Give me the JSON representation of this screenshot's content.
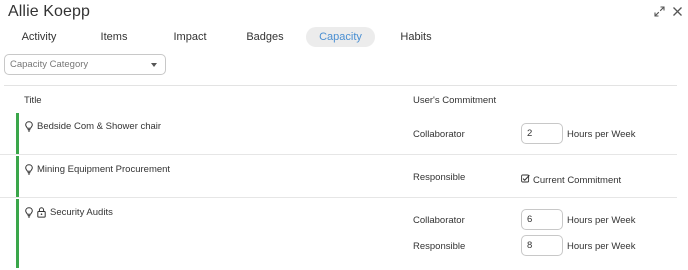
{
  "window": {
    "title": "Allie Koepp",
    "icons": [
      "expand-icon",
      "close-icon"
    ]
  },
  "tabs": [
    {
      "label": "Activity",
      "active": false
    },
    {
      "label": "Items",
      "active": false
    },
    {
      "label": "Impact",
      "active": false
    },
    {
      "label": "Badges",
      "active": false
    },
    {
      "label": "Capacity",
      "active": true
    },
    {
      "label": "Habits",
      "active": false
    }
  ],
  "filter": {
    "placeholder": "Capacity Category"
  },
  "table": {
    "columns": {
      "title": "Title",
      "commitment": "User's Commitment"
    },
    "rows": [
      {
        "title": "Bedside Com & Shower chair",
        "icons": [
          "lightbulb-icon"
        ],
        "commitments": [
          {
            "role": "Collaborator",
            "type": "hours",
            "value": "2",
            "unit": "Hours per Week"
          }
        ]
      },
      {
        "title": "Mining Equipment Procurement",
        "icons": [
          "lightbulb-icon"
        ],
        "commitments": [
          {
            "role": "Responsible",
            "type": "checkbox",
            "checked": true,
            "label": "Current Commitment"
          }
        ]
      },
      {
        "title": "Security Audits",
        "icons": [
          "lightbulb-icon",
          "lock-icon"
        ],
        "commitments": [
          {
            "role": "Collaborator",
            "type": "hours",
            "value": "6",
            "unit": "Hours per Week"
          },
          {
            "role": "Responsible",
            "type": "hours",
            "value": "8",
            "unit": "Hours per Week"
          }
        ]
      }
    ]
  },
  "colors": {
    "accent": "#4a8fd2",
    "row_indicator": "#3aa64a",
    "active_tab_bg": "#ececec"
  }
}
